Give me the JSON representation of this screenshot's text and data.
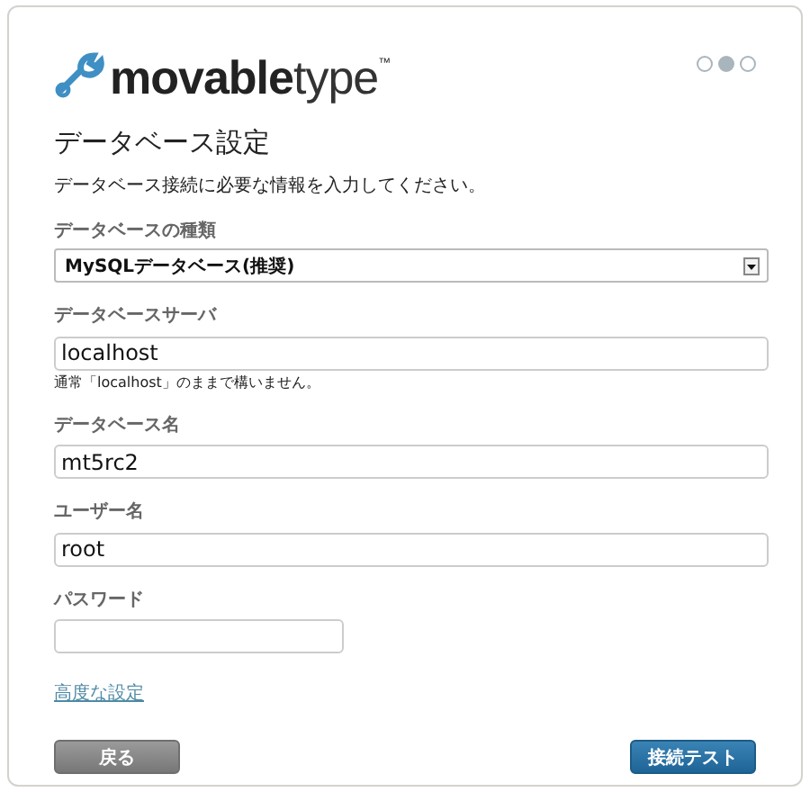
{
  "logo": {
    "strong": "movable",
    "light": "type",
    "mark": "™"
  },
  "steps": [
    {
      "selected": false
    },
    {
      "selected": true
    },
    {
      "selected": false
    }
  ],
  "title": "データベース設定",
  "intro": "データベース接続に必要な情報を入力してください。",
  "fields": [
    {
      "kind": "select",
      "label": "データベースの種類",
      "value": "MySQLデータベース(推奨)"
    },
    {
      "kind": "text",
      "label": "データベースサーバ",
      "value": "localhost",
      "hint": "通常「localhost」のままで構いません。"
    },
    {
      "kind": "text",
      "label": "データベース名",
      "value": "mt5rc2"
    },
    {
      "kind": "text",
      "label": "ユーザー名",
      "value": "root"
    },
    {
      "kind": "password",
      "label": "パスワード"
    }
  ],
  "advanced_link": "高度な設定",
  "buttons": {
    "back": "戻る",
    "test": "接続テスト"
  }
}
